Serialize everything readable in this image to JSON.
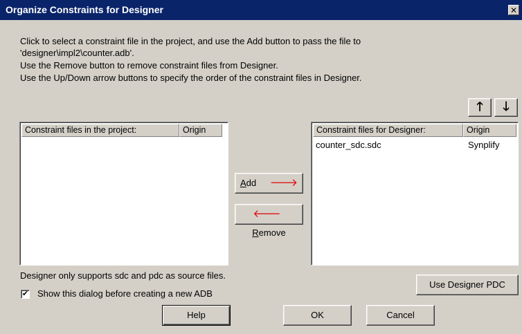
{
  "window": {
    "title": "Organize Constraints for Designer",
    "close_glyph": "✕"
  },
  "instructions": [
    "Click to select a constraint file in the project, and use the Add button to pass the file to",
    "'designer\\impl2\\counter.adb'.",
    "Use the Remove button to remove constraint files from Designer.",
    "Use the Up/Down arrow buttons to specify the order of the constraint files in Designer."
  ],
  "project_list": {
    "col_file": "Constraint files in the project:",
    "col_origin": "Origin",
    "rows": []
  },
  "designer_list": {
    "col_file": "Constraint files for Designer:",
    "col_origin": "Origin",
    "rows": [
      {
        "file": "counter_sdc.sdc",
        "origin": "Synplify"
      }
    ]
  },
  "buttons": {
    "add_underlined": "A",
    "add_rest": "dd",
    "remove_underlined": "R",
    "remove_rest": "emove",
    "up_arrow": "🡑",
    "down_arrow": "🡓",
    "use_designer_pdc": "Use Designer PDC",
    "help": "Help",
    "ok": "OK",
    "cancel": "Cancel"
  },
  "icons": {
    "add_arrow": "right-arrow-icon",
    "remove_arrow": "left-arrow-icon",
    "arrow_color": "#e00000"
  },
  "support_note": "Designer only supports sdc and pdc as source files.",
  "show_dialog": {
    "checked": true,
    "check_glyph": "✔",
    "label": "Show this dialog before creating a new ADB"
  },
  "colors": {
    "titlebar": "#0a246a",
    "face": "#d4d0c8"
  }
}
